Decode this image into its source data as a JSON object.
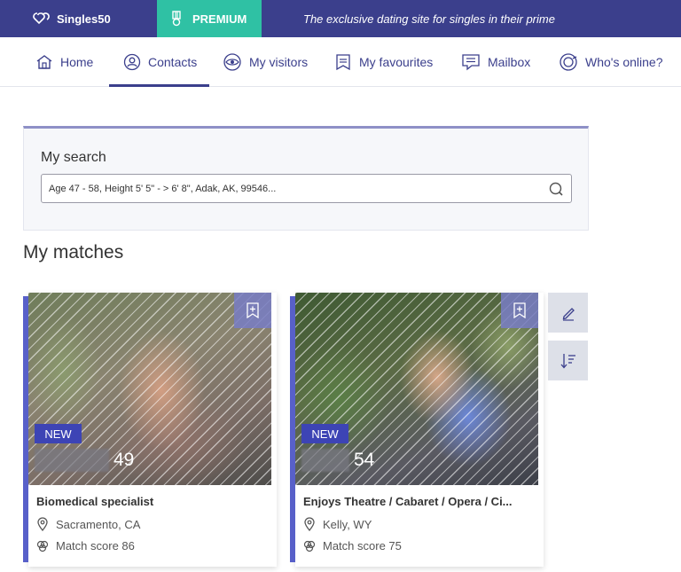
{
  "topbar": {
    "logo_text": "Singles50",
    "premium_label": "PREMIUM",
    "tagline": "The exclusive dating site for singles in their prime"
  },
  "nav": {
    "items": [
      {
        "label": "Home",
        "icon": "home-icon"
      },
      {
        "label": "Contacts",
        "icon": "contacts-icon",
        "active": true
      },
      {
        "label": "My visitors",
        "icon": "eye-icon"
      },
      {
        "label": "My favourites",
        "icon": "favourites-icon"
      },
      {
        "label": "Mailbox",
        "icon": "mailbox-icon"
      },
      {
        "label": "Who's online?",
        "icon": "online-icon"
      }
    ]
  },
  "search": {
    "label": "My search",
    "value": "Age 47 - 58, Height 5' 5\" - > 6' 8\", Adak, AK, 99546..."
  },
  "matches": {
    "title": "My matches",
    "cards": [
      {
        "badge": "NEW",
        "age": "49",
        "headline": "Biomedical specialist",
        "location": "Sacramento, CA",
        "match_score": "Match score 86"
      },
      {
        "badge": "NEW",
        "age": "54",
        "headline": "Enjoys Theatre / Cabaret / Opera / Ci...",
        "location": "Kelly, WY",
        "match_score": "Match score 75"
      }
    ]
  },
  "tools": {
    "edit_icon": "pencil-icon",
    "sort_icon": "sort-icon"
  },
  "colors": {
    "brand": "#3b3f8c",
    "premium": "#2fc1a4",
    "accent": "#5860c9",
    "badge": "#3d44b5"
  }
}
